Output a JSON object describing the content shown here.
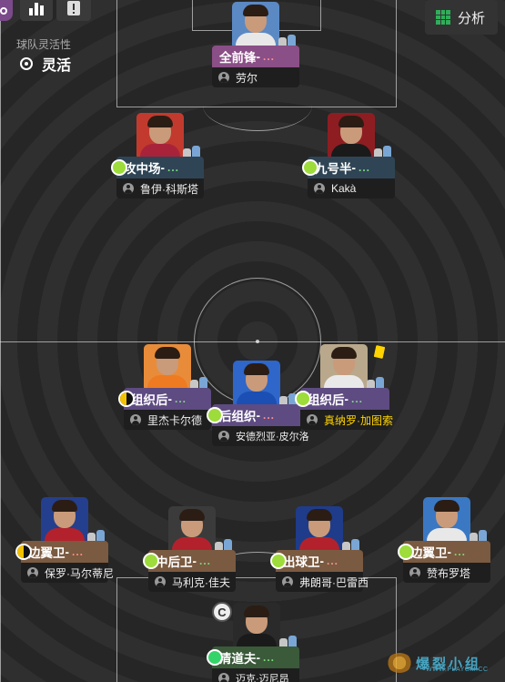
{
  "toolbar": {
    "analysis_label": "分析",
    "accent": "#7a4a8a"
  },
  "team_flex": {
    "title": "球队灵活性",
    "value": "灵活"
  },
  "players": [
    {
      "id": "fw",
      "role": "全前锋",
      "role_suffix": " -",
      "dots": "...",
      "name": "劳尔",
      "role_color": "#8a4f86",
      "familiarity": "none",
      "shirt": "#e8e8e8",
      "photo_bg": "#5b89c4"
    },
    {
      "id": "am_l",
      "role": "攻中场",
      "role_suffix": " -",
      "dots": "...",
      "name": "鲁伊·科斯塔",
      "role_color": "#2f4556",
      "familiarity": "full",
      "shirt": "#a8233a",
      "photo_bg": "#c23a2e"
    },
    {
      "id": "am_r",
      "role": "九号半",
      "role_suffix": " -",
      "dots": "...",
      "name": "Kakà",
      "role_color": "#2f4556",
      "familiarity": "full",
      "shirt": "#1a1a1a",
      "photo_bg": "#8e1d22"
    },
    {
      "id": "dm_l",
      "role": "组织后",
      "role_suffix": " -",
      "dots": "...",
      "name": "里杰卡尔德",
      "role_color": "#5e4b82",
      "familiarity": "half",
      "shirt": "#ee7b22",
      "photo_bg": "#e88c3a"
    },
    {
      "id": "dm_c",
      "role": "后组织",
      "role_suffix": " -",
      "dots": "...",
      "name": "安德烈亚·皮尔洛",
      "role_color": "#5e4b82",
      "familiarity": "full",
      "shirt": "#1c4fb3",
      "photo_bg": "#2e66c9"
    },
    {
      "id": "dm_r",
      "role": "组织后",
      "role_suffix": " -",
      "dots": "...",
      "name": "真纳罗·加图索",
      "role_color": "#5e4b82",
      "familiarity": "full",
      "shirt": "#e9e9e9",
      "photo_bg": "#b9a88b",
      "name_color": "#ffd400",
      "yellow_card": true
    },
    {
      "id": "lb",
      "role": "边翼卫",
      "role_suffix": " -",
      "dots": "...",
      "name": "保罗·马尔蒂尼",
      "role_color": "#7a5a40",
      "familiarity": "half",
      "shirt": "#b3222c",
      "photo_bg": "#243f8d"
    },
    {
      "id": "cb_l",
      "role": "中后卫",
      "role_suffix": " -",
      "dots": "...",
      "name": "马利克·佳夫",
      "role_color": "#7a5a40",
      "familiarity": "full",
      "shirt": "#b3222c",
      "photo_bg": "#3b3b3b"
    },
    {
      "id": "cb_r",
      "role": "出球卫",
      "role_suffix": " -",
      "dots": "...",
      "name": "弗朗哥·巴雷西",
      "role_color": "#7a5a40",
      "familiarity": "full",
      "shirt": "#b3222c",
      "photo_bg": "#1f3c8a"
    },
    {
      "id": "rb",
      "role": "边翼卫",
      "role_suffix": " -",
      "dots": "...",
      "name": "赞布罗塔",
      "role_color": "#7a5a40",
      "familiarity": "full",
      "shirt": "#e8e8e8",
      "photo_bg": "#3a78c4"
    },
    {
      "id": "gk",
      "role": "清道夫",
      "role_suffix": " -",
      "dots": "...",
      "name": "迈克·迈尼昂",
      "role_color": "#3a5a3a",
      "familiarity": "green",
      "shirt": "#1a1a1a",
      "photo_bg": "#2a2a2a"
    }
  ],
  "captain_label": "C",
  "watermark": {
    "text": "爆裂小组",
    "url": "WWW.PLAYGM.CC"
  }
}
